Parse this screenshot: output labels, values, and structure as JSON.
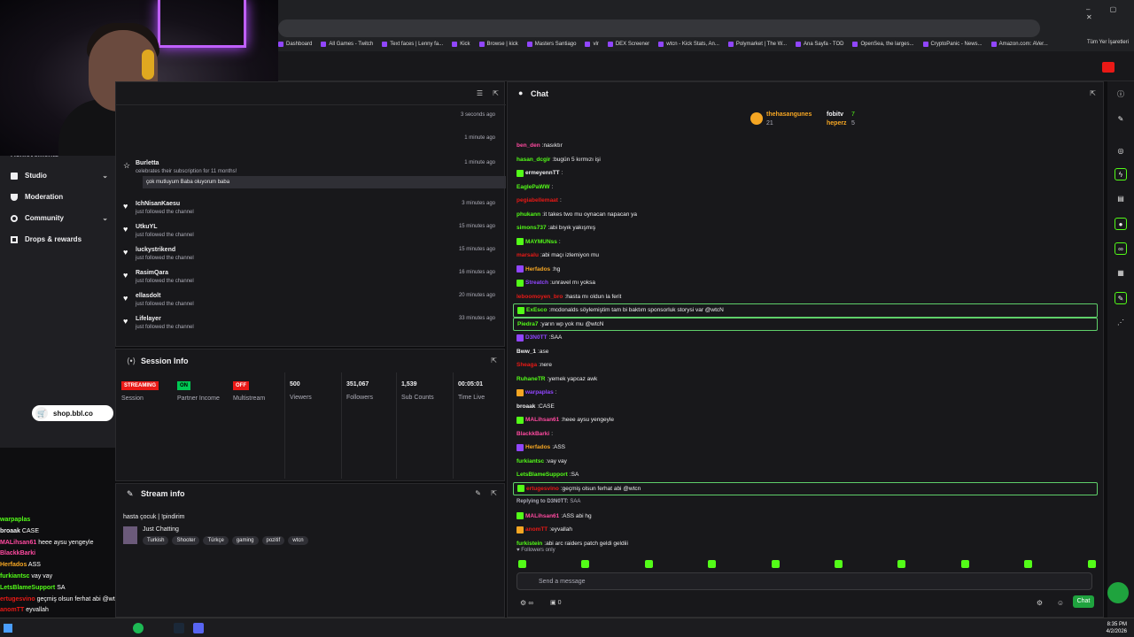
{
  "browser": {
    "bookmarks": [
      "Dashboard",
      "All Games - Twitch",
      "Text faces | Lenny fa...",
      "Kick",
      "Browse | kick",
      "Masters Santiago",
      "vlr",
      "DEX Screener",
      "wtcn - Kick Stats, An...",
      "Polymarket | The W...",
      "Ana Sayfa - TOD",
      "OpenSea, the larges...",
      "CryptoPanic - News...",
      "Amazon.com: AVer..."
    ],
    "all_bookmarks": "Tüm Yer İşaretleri"
  },
  "sidebar": {
    "partial_item": "Achievements",
    "items": [
      {
        "label": "Studio",
        "has_chevron": true
      },
      {
        "label": "Moderation",
        "has_chevron": false
      },
      {
        "label": "Community",
        "has_chevron": true
      },
      {
        "label": "Drops & rewards",
        "has_chevron": false
      }
    ]
  },
  "shop_badge": "shop.bbl.co",
  "activity_feed": {
    "items": [
      {
        "time": "3 seconds ago"
      },
      {
        "time": "1 minute ago"
      },
      {
        "name": "Burletta",
        "desc": "celebrates their subscription for 11 months!",
        "message": "çok mutluyum Baba oluyorum baba",
        "time": "1 minute ago"
      },
      {
        "name": "IchNisanKaesu",
        "desc": "just followed the channel",
        "time": "3 minutes ago"
      },
      {
        "name": "UtkuYL",
        "desc": "just followed the channel",
        "time": "15 minutes ago"
      },
      {
        "name": "luckystrikend",
        "desc": "just followed the channel",
        "time": "15 minutes ago"
      },
      {
        "name": "RasimQara",
        "desc": "just followed the channel",
        "time": "16 minutes ago"
      },
      {
        "name": "ellasdolt",
        "desc": "just followed the channel",
        "time": "20 minutes ago"
      },
      {
        "name": "Lifelayer",
        "desc": "just followed the channel",
        "time": "33 minutes ago"
      }
    ]
  },
  "session_info": {
    "title": "Session Info",
    "stats": [
      {
        "tag": "STREAMING",
        "label": "Session",
        "color": "#e91916"
      },
      {
        "tag": "ON",
        "label": "Partner Income",
        "color": "#00c853"
      },
      {
        "tag": "OFF",
        "label": "Multistream",
        "color": "#e91916"
      },
      {
        "value": "500",
        "label": "Viewers"
      },
      {
        "value": "351,067",
        "label": "Followers"
      },
      {
        "value": "1,539",
        "label": "Sub Counts"
      },
      {
        "value": "00:05:01",
        "label": "Time Live"
      }
    ]
  },
  "stream_info": {
    "title": "Stream info",
    "stream_title": "hasta çocuk | !pindirim",
    "category": "Just Chatting",
    "tags": [
      "Turkish",
      "Shooter",
      "Türkçe",
      "gaming",
      "pozitif",
      "wtcn"
    ]
  },
  "overlay_chat": [
    {
      "user": "warpaplas",
      "msg": "",
      "color": "#53fc18"
    },
    {
      "user": "broaak",
      "msg": "CASE",
      "color": "#efeff1"
    },
    {
      "user": "MALihsan61",
      "msg": "heee aysu yengeyle",
      "color": "#ff4aa0"
    },
    {
      "user": "BlackkBarki",
      "msg": "",
      "color": "#ff4aa0"
    },
    {
      "user": "Herfados",
      "msg": "ASS",
      "color": "#f5a623"
    },
    {
      "user": "furkiantsc",
      "msg": "vay vay",
      "color": "#53fc18"
    },
    {
      "user": "LetsBlameSupport",
      "msg": "SA",
      "color": "#53fc18"
    },
    {
      "user": "ertugesvino",
      "msg": "geçmiş olsun ferhat abi @wtcn",
      "color": "#e91916"
    },
    {
      "user": "anomTT",
      "msg": "eyvallah",
      "color": "#e91916"
    },
    {
      "user": "furkistein",
      "msg": "abi arc raiders patch geldi geldiii",
      "color": "#53fc18"
    }
  ],
  "chat": {
    "title": "Chat",
    "pinned": {
      "user1": "thehasangunes",
      "count1": "21",
      "user2": "fobitv",
      "count2": "7",
      "user3": "heperz",
      "count3": "5"
    },
    "lines": [
      {
        "user": "ben_den",
        "msg": "nasıktır",
        "color": "#ff4aa0"
      },
      {
        "user": "hasan_dcgir",
        "msg": "bugün 5 kırmızı işi",
        "color": "#53fc18"
      },
      {
        "user": "ermeyennTT",
        "msg": "",
        "color": "#efeff1",
        "badge": "#53fc18"
      },
      {
        "user": "EaglePaWW",
        "msg": "",
        "color": "#53fc18"
      },
      {
        "user": "pegiabellemaat",
        "msg": "",
        "color": "#e91916"
      },
      {
        "user": "phukann",
        "msg": "it takes two mu oynacan napacan ya",
        "color": "#53fc18"
      },
      {
        "user": "simons737",
        "msg": "abi bıyık yakışmış",
        "color": "#53fc18"
      },
      {
        "user": "MAYMUNss",
        "msg": "",
        "color": "#53fc18",
        "badge": "#53fc18"
      },
      {
        "user": "marsalu",
        "msg": "abi maçı izlemiyon mu",
        "color": "#e91916"
      },
      {
        "user": "Herfados",
        "msg": "hg",
        "color": "#f5a623",
        "badge": "#9146ff"
      },
      {
        "user": "Streatch",
        "msg": "unravel mı yoksa",
        "color": "#9146ff",
        "badge": "#53fc18"
      },
      {
        "user": "leboomoyen_bro",
        "msg": "hasta mı oldun la ferit",
        "color": "#e91916"
      },
      {
        "user": "ExEsco",
        "msg": "mcdonalds söylemiştim tam bi baktım sponsorluk storysi var @wtcN",
        "color": "#53fc18",
        "badge": "#53fc18",
        "highlight": true
      },
      {
        "user": "Piedra7",
        "msg": "yarın wp yok mu @wtcN",
        "color": "#53fc18",
        "highlight": true
      },
      {
        "user": "D3N0TT",
        "msg": "SAA",
        "color": "#9146ff",
        "badge": "#9146ff"
      },
      {
        "user": "Bww_1",
        "msg": "ase",
        "color": "#efeff1"
      },
      {
        "user": "Sheaga",
        "msg": "nere",
        "color": "#e91916"
      },
      {
        "user": "RuhaneTR",
        "msg": "yemek yapcaz awk",
        "color": "#53fc18"
      },
      {
        "user": "warpaplas",
        "msg": "",
        "color": "#9146ff",
        "badge": "#f5a623"
      },
      {
        "user": "broaak",
        "msg": "CASE",
        "color": "#efeff1"
      },
      {
        "user": "MALihsan61",
        "msg": "heee aysu yengeyle",
        "color": "#ff4aa0",
        "badge": "#53fc18"
      },
      {
        "user": "BlackkBarki",
        "msg": "",
        "color": "#ff4aa0"
      },
      {
        "user": "Herfados",
        "msg": "ASS",
        "color": "#f5a623",
        "badge": "#9146ff"
      },
      {
        "user": "furkiantsc",
        "msg": "vay vay",
        "color": "#53fc18"
      },
      {
        "user": "LetsBlameSupport",
        "msg": "SA",
        "color": "#53fc18"
      },
      {
        "user": "ertugesvino",
        "msg": "geçmiş olsun ferhat abi @wtcn",
        "color": "#e91916",
        "badge": "#53fc18",
        "highlight": true
      },
      {
        "user": "Replying to D3N0TT:",
        "msg": "SAA",
        "color": "#adadb8",
        "reply": true
      },
      {
        "user": "MALihsan61",
        "msg": "ASS abi hg",
        "color": "#ff4aa0",
        "badge": "#53fc18"
      },
      {
        "user": "anomTT",
        "msg": "eyvallah",
        "color": "#e91916",
        "badge": "#f5a623"
      },
      {
        "user": "furkistein",
        "msg": "abi arc raiders patch geldi geldiii",
        "color": "#53fc18"
      }
    ],
    "followers_only": "Followers only",
    "input_placeholder": "Send a message",
    "send_label": "Chat",
    "viewers_count": "0"
  },
  "taskbar": {
    "time": "8:35 PM",
    "date": "4/2/2026"
  }
}
